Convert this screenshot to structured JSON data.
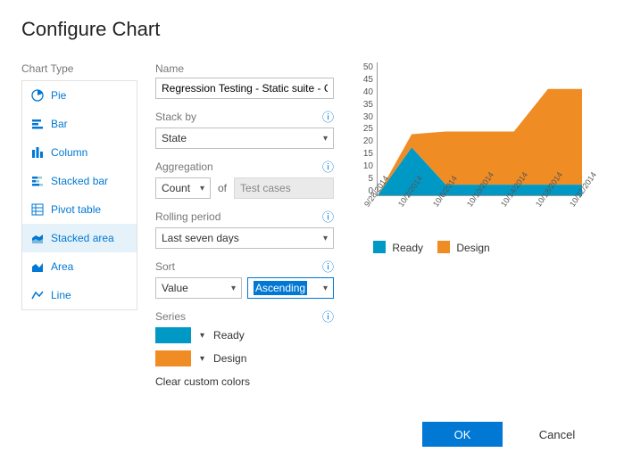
{
  "title": "Configure Chart",
  "sidebar": {
    "label": "Chart Type",
    "items": [
      {
        "id": "pie",
        "label": "Pie"
      },
      {
        "id": "bar",
        "label": "Bar"
      },
      {
        "id": "column",
        "label": "Column"
      },
      {
        "id": "stacked-bar",
        "label": "Stacked bar"
      },
      {
        "id": "pivot-table",
        "label": "Pivot table"
      },
      {
        "id": "stacked-area",
        "label": "Stacked area",
        "selected": true
      },
      {
        "id": "area",
        "label": "Area"
      },
      {
        "id": "line",
        "label": "Line"
      }
    ]
  },
  "form": {
    "name_label": "Name",
    "name_value": "Regression Testing - Static suite - Chart",
    "stackby_label": "Stack by",
    "stackby_value": "State",
    "agg_label": "Aggregation",
    "agg_value": "Count",
    "agg_of": "of",
    "agg_target": "Test cases",
    "rolling_label": "Rolling period",
    "rolling_value": "Last seven days",
    "sort_label": "Sort",
    "sort_field": "Value",
    "sort_dir": "Ascending",
    "series_label": "Series",
    "series": [
      {
        "label": "Ready",
        "color": "#0099c6"
      },
      {
        "label": "Design",
        "color": "#f08c24"
      }
    ],
    "clear_colors": "Clear custom colors"
  },
  "buttons": {
    "ok": "OK",
    "cancel": "Cancel"
  },
  "chart_data": {
    "type": "area",
    "stacked": true,
    "title": "",
    "xlabel": "",
    "ylabel": "",
    "ylim": [
      0,
      50
    ],
    "y_ticks": [
      50,
      45,
      40,
      35,
      30,
      25,
      20,
      15,
      10,
      5,
      0
    ],
    "categories": [
      "9/28/2014",
      "10/2/2014",
      "10/6/2014",
      "10/10/2014",
      "10/14/2014",
      "10/18/2014",
      "10/22/2014"
    ],
    "series": [
      {
        "name": "Ready",
        "color": "#0099c6",
        "values": [
          0,
          18,
          4,
          4,
          4,
          4,
          4
        ]
      },
      {
        "name": "Design",
        "color": "#f08c24",
        "values": [
          0,
          5,
          20,
          20,
          20,
          36,
          36
        ]
      }
    ]
  }
}
